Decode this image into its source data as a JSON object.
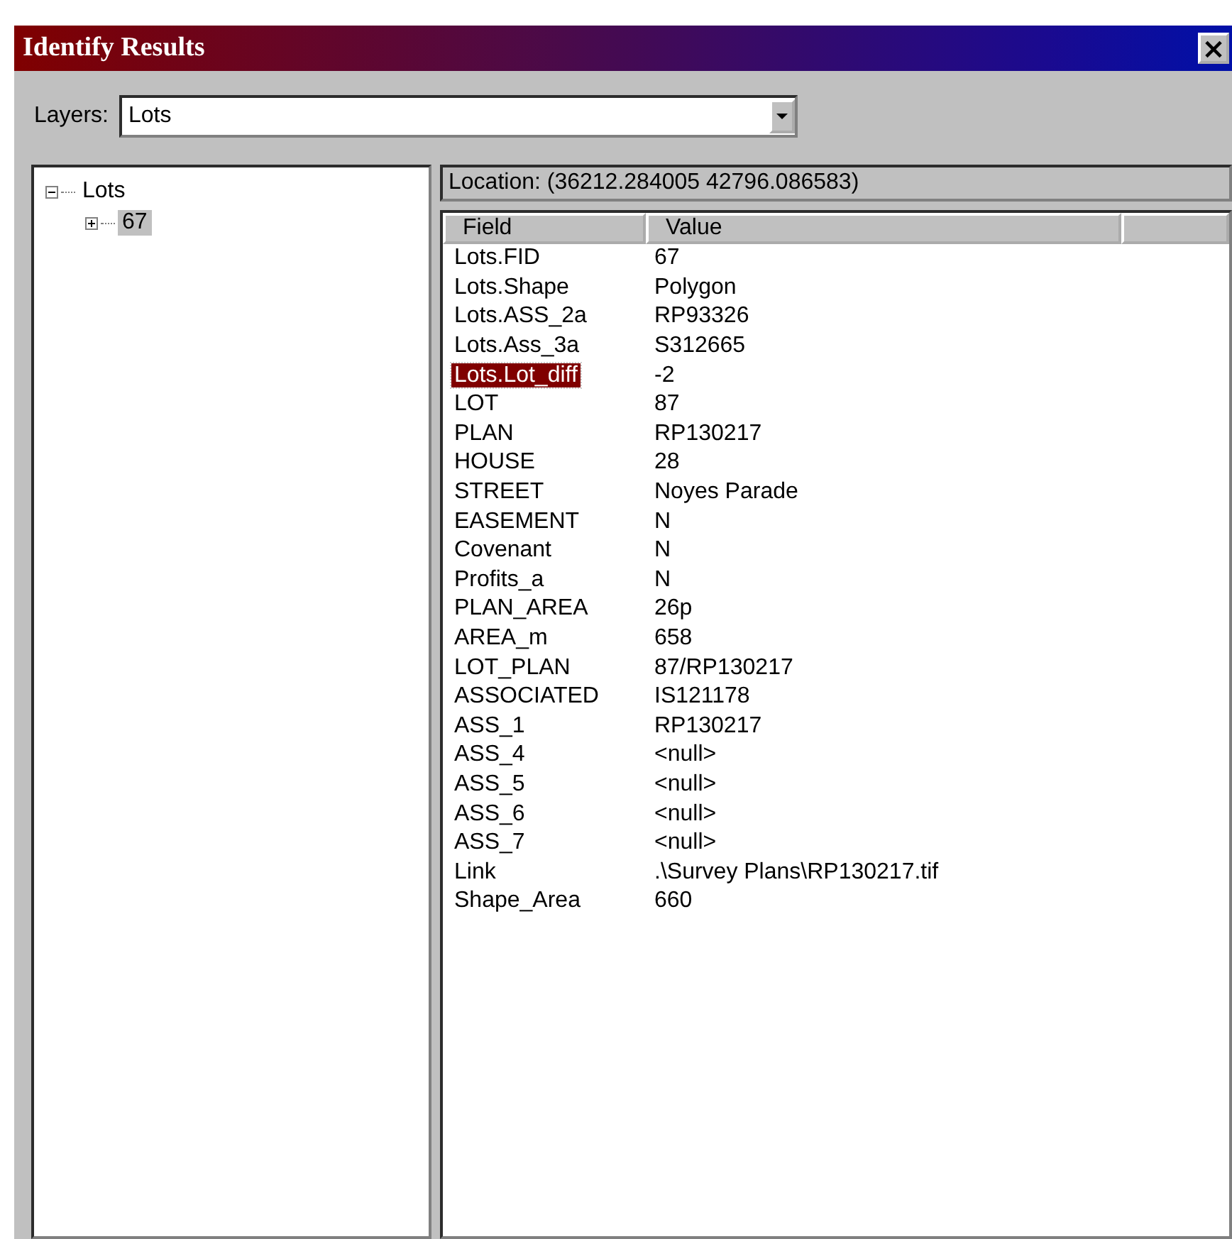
{
  "window": {
    "title": "Identify Results",
    "close": "×"
  },
  "layers": {
    "label": "Layers:",
    "value": "Lots"
  },
  "tree": [
    {
      "label": "Lots",
      "expanded": true,
      "selected": false,
      "children": [
        {
          "label": "67",
          "expanded": false,
          "selected": true
        }
      ]
    }
  ],
  "location": "Location: (36212.284005 42796.086583)",
  "table": {
    "columns": [
      "Field",
      "Value"
    ],
    "rows": [
      {
        "field": "Lots.FID",
        "value": "67",
        "selected": false
      },
      {
        "field": "Lots.Shape",
        "value": "Polygon",
        "selected": false
      },
      {
        "field": "Lots.ASS_2a",
        "value": "RP93326",
        "selected": false
      },
      {
        "field": "Lots.Ass_3a",
        "value": "S312665",
        "selected": false
      },
      {
        "field": "Lots.Lot_diff",
        "value": "-2",
        "selected": true
      },
      {
        "field": "LOT",
        "value": "87",
        "selected": false
      },
      {
        "field": "PLAN",
        "value": "RP130217",
        "selected": false
      },
      {
        "field": "HOUSE",
        "value": "28",
        "selected": false
      },
      {
        "field": "STREET",
        "value": "Noyes Parade",
        "selected": false
      },
      {
        "field": "EASEMENT",
        "value": "N",
        "selected": false
      },
      {
        "field": "Covenant",
        "value": "N",
        "selected": false
      },
      {
        "field": "Profits_a",
        "value": "N",
        "selected": false
      },
      {
        "field": "PLAN_AREA",
        "value": "26p",
        "selected": false
      },
      {
        "field": "AREA_m",
        "value": "658",
        "selected": false
      },
      {
        "field": "LOT_PLAN",
        "value": "87/RP130217",
        "selected": false
      },
      {
        "field": "ASSOCIATED",
        "value": "IS121178",
        "selected": false
      },
      {
        "field": "ASS_1",
        "value": "RP130217",
        "selected": false
      },
      {
        "field": "ASS_4",
        "value": "<null>",
        "selected": false
      },
      {
        "field": "ASS_5",
        "value": "<null>",
        "selected": false
      },
      {
        "field": "ASS_6",
        "value": "<null>",
        "selected": false
      },
      {
        "field": "ASS_7",
        "value": "<null>",
        "selected": false
      },
      {
        "field": "Link",
        "value": ".\\Survey Plans\\RP130217.tif",
        "selected": false
      },
      {
        "field": "Shape_Area",
        "value": "660",
        "selected": false
      }
    ]
  }
}
